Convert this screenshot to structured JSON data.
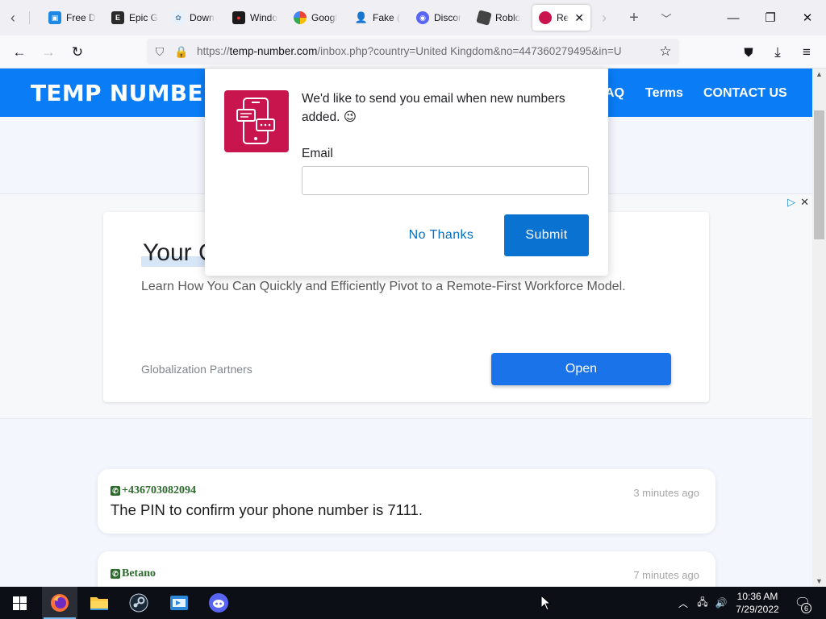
{
  "browser": {
    "tabs": [
      {
        "label": "Free D",
        "favicon": "free-d-favicon"
      },
      {
        "label": "Epic G",
        "favicon": "epic-games-favicon"
      },
      {
        "label": "Down",
        "favicon": "download-favicon"
      },
      {
        "label": "Windo",
        "favicon": "windows-favicon"
      },
      {
        "label": "Googl",
        "favicon": "google-favicon"
      },
      {
        "label": "Fake (",
        "favicon": "fake-name-favicon"
      },
      {
        "label": "Discor",
        "favicon": "discord-favicon"
      },
      {
        "label": "Roblo",
        "favicon": "roblox-favicon"
      },
      {
        "label": "Re",
        "favicon": "temp-number-favicon"
      }
    ],
    "url_host": "temp-number.com",
    "url_prefix": "https://",
    "url_rest": "/inbox.php?country=United Kingdom&no=447360279495&in=U"
  },
  "site": {
    "logo": "TEMP NUMBER",
    "nav": [
      "AQ",
      "Terms",
      "CONTACT US"
    ]
  },
  "ad": {
    "title": "Your C",
    "description": "Learn How You Can Quickly and Efficiently Pivot to a Remote-First Workforce Model.",
    "advertiser": "Globalization Partners",
    "button": "Open"
  },
  "messages": [
    {
      "sender": "+436703082094",
      "time": "3 minutes ago",
      "body": "The PIN to confirm your phone number is 7111."
    },
    {
      "sender": "Betano",
      "time": "7 minutes ago",
      "body": ""
    }
  ],
  "popup": {
    "message": "We'd like to send you email when new numbers added. 😉",
    "email_label": "Email",
    "email_value": "",
    "no_thanks": "No Thanks",
    "submit": "Submit"
  },
  "taskbar": {
    "time": "10:36 AM",
    "date": "7/29/2022",
    "notification_count": "6"
  },
  "colors": {
    "header_blue": "#0a7cf5",
    "popup_accent": "#c8154e",
    "submit_blue": "#0a72d1",
    "sender_green": "#2d6a2d"
  }
}
